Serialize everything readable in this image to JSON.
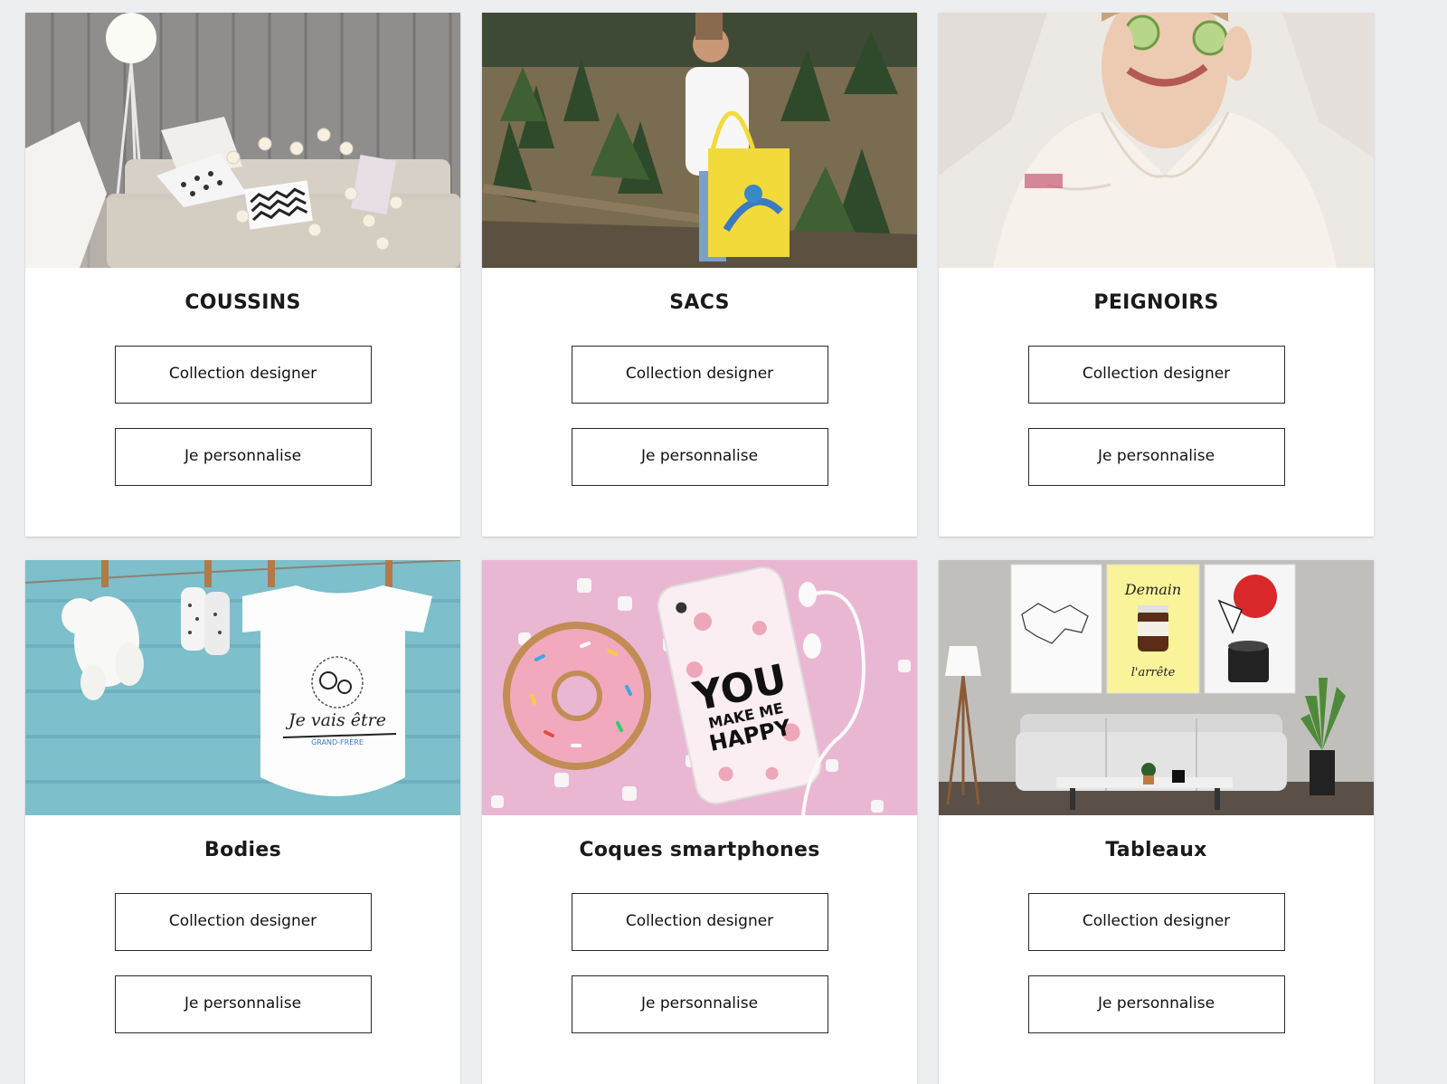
{
  "products": [
    {
      "title": "COUSSINS",
      "collection_label": "Collection designer",
      "personalize_label": "Je personnalise"
    },
    {
      "title": "SACS",
      "collection_label": "Collection designer",
      "personalize_label": "Je personnalise"
    },
    {
      "title": "PEIGNOIRS",
      "collection_label": "Collection designer",
      "personalize_label": "Je personnalise"
    },
    {
      "title": "Bodies",
      "collection_label": "Collection designer",
      "personalize_label": "Je personnalise",
      "image_text": {
        "line1": "Je vais être",
        "line2": "GRAND-FRÈRE"
      }
    },
    {
      "title": "Coques smartphones",
      "collection_label": "Collection designer",
      "personalize_label": "Je personnalise",
      "image_text": {
        "line1": "YOU",
        "line2": "MAKE ME",
        "line3": "HAPPY"
      }
    },
    {
      "title": "Tableaux",
      "collection_label": "Collection designer",
      "personalize_label": "Je personnalise",
      "image_text": {
        "line1": "Demain",
        "line2": "l'arrête"
      }
    }
  ]
}
